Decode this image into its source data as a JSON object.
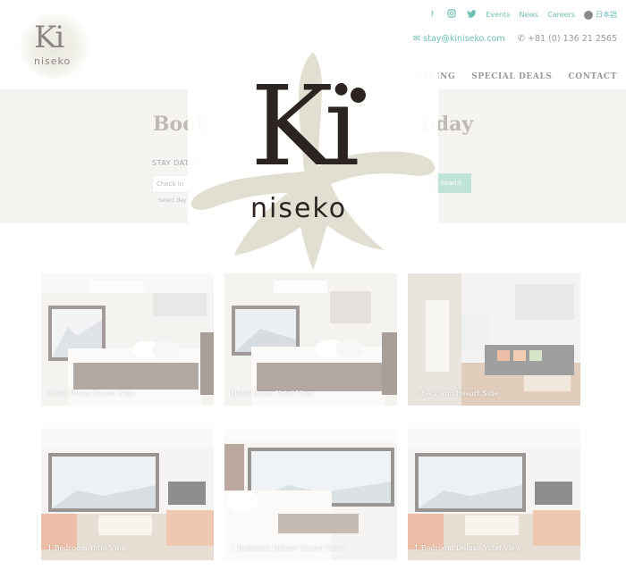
{
  "brand": {
    "logo_ki": "Ki",
    "logo_niseko": "niseko"
  },
  "top_links": {
    "events": "Events",
    "news": "News",
    "careers": "Careers",
    "language": "日本語"
  },
  "social_icons": [
    "facebook-icon",
    "instagram-icon",
    "twitter-icon"
  ],
  "contact": {
    "email": "stay@kiniseko.com",
    "phone": "+81 (0) 136 21 2565"
  },
  "nav": [
    "DINING",
    "SPECIAL DEALS",
    "CONTACT"
  ],
  "booking": {
    "title": "Book Your Stay Today",
    "title_left": "Book",
    "title_right": "oday",
    "stay_label": "STAY DATES",
    "checkin_placeholder": "Check in",
    "select_hint": "Select day",
    "search_label": "Search"
  },
  "rooms": [
    {
      "label": "Hotel Room Resort Side"
    },
    {
      "label": "Hotel Room Yotei View"
    },
    {
      "label": "1 Bedroom Resort Side"
    },
    {
      "label": "1 Bedroom Yotei View"
    },
    {
      "label": "1 Bedroom Deluxe Resort View"
    },
    {
      "label": "1 Bedroom Deluxe Yotei View"
    }
  ],
  "colors": {
    "accent": "#6fbfb3",
    "band": "#f5f4f1",
    "ink": "#2b2421",
    "search": "#bfe3d7"
  }
}
